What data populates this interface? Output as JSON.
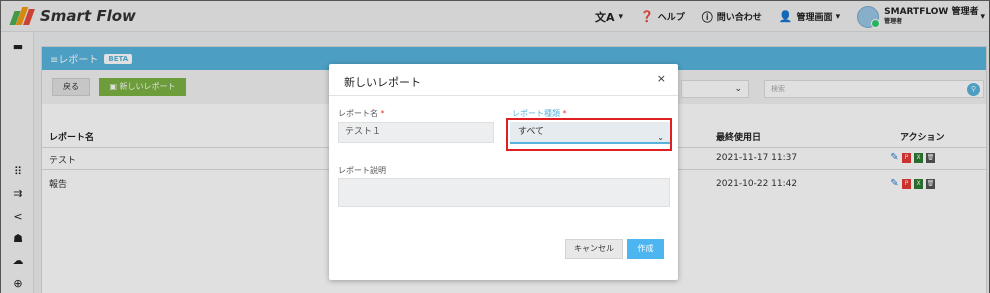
{
  "app": {
    "logo_text": "Smart Flow"
  },
  "topbar": {
    "lang": "文A",
    "help": "ヘルプ",
    "contact": "問い合わせ",
    "admin": "管理画面",
    "user_name": "SMARTFLOW 管理者",
    "user_role": "管理者"
  },
  "panel": {
    "title": "≡レポート",
    "badge": "BETA",
    "back": "戻る",
    "new_report": "新しいレポート",
    "search_placeholder": "検索"
  },
  "table": {
    "headers": {
      "name": "レポート名",
      "last_used": "最終使用日",
      "actions": "アクション"
    },
    "rows": [
      {
        "name": "テスト",
        "last_used": "2021-11-17 11:37"
      },
      {
        "name": "報告",
        "last_used": "2021-10-22 11:42"
      }
    ]
  },
  "modal": {
    "title": "新しいレポート",
    "close": "×",
    "name_label": "レポート名",
    "name_value": "テスト１",
    "type_label": "レポート種類",
    "type_value": "すべて",
    "desc_label": "レポート説明",
    "desc_value": "",
    "required_mark": "*",
    "cancel": "キャンセル",
    "create": "作成"
  },
  "colors": {
    "accent": "#58b4de",
    "new_button": "#7cb342",
    "highlight": "#e02020"
  }
}
